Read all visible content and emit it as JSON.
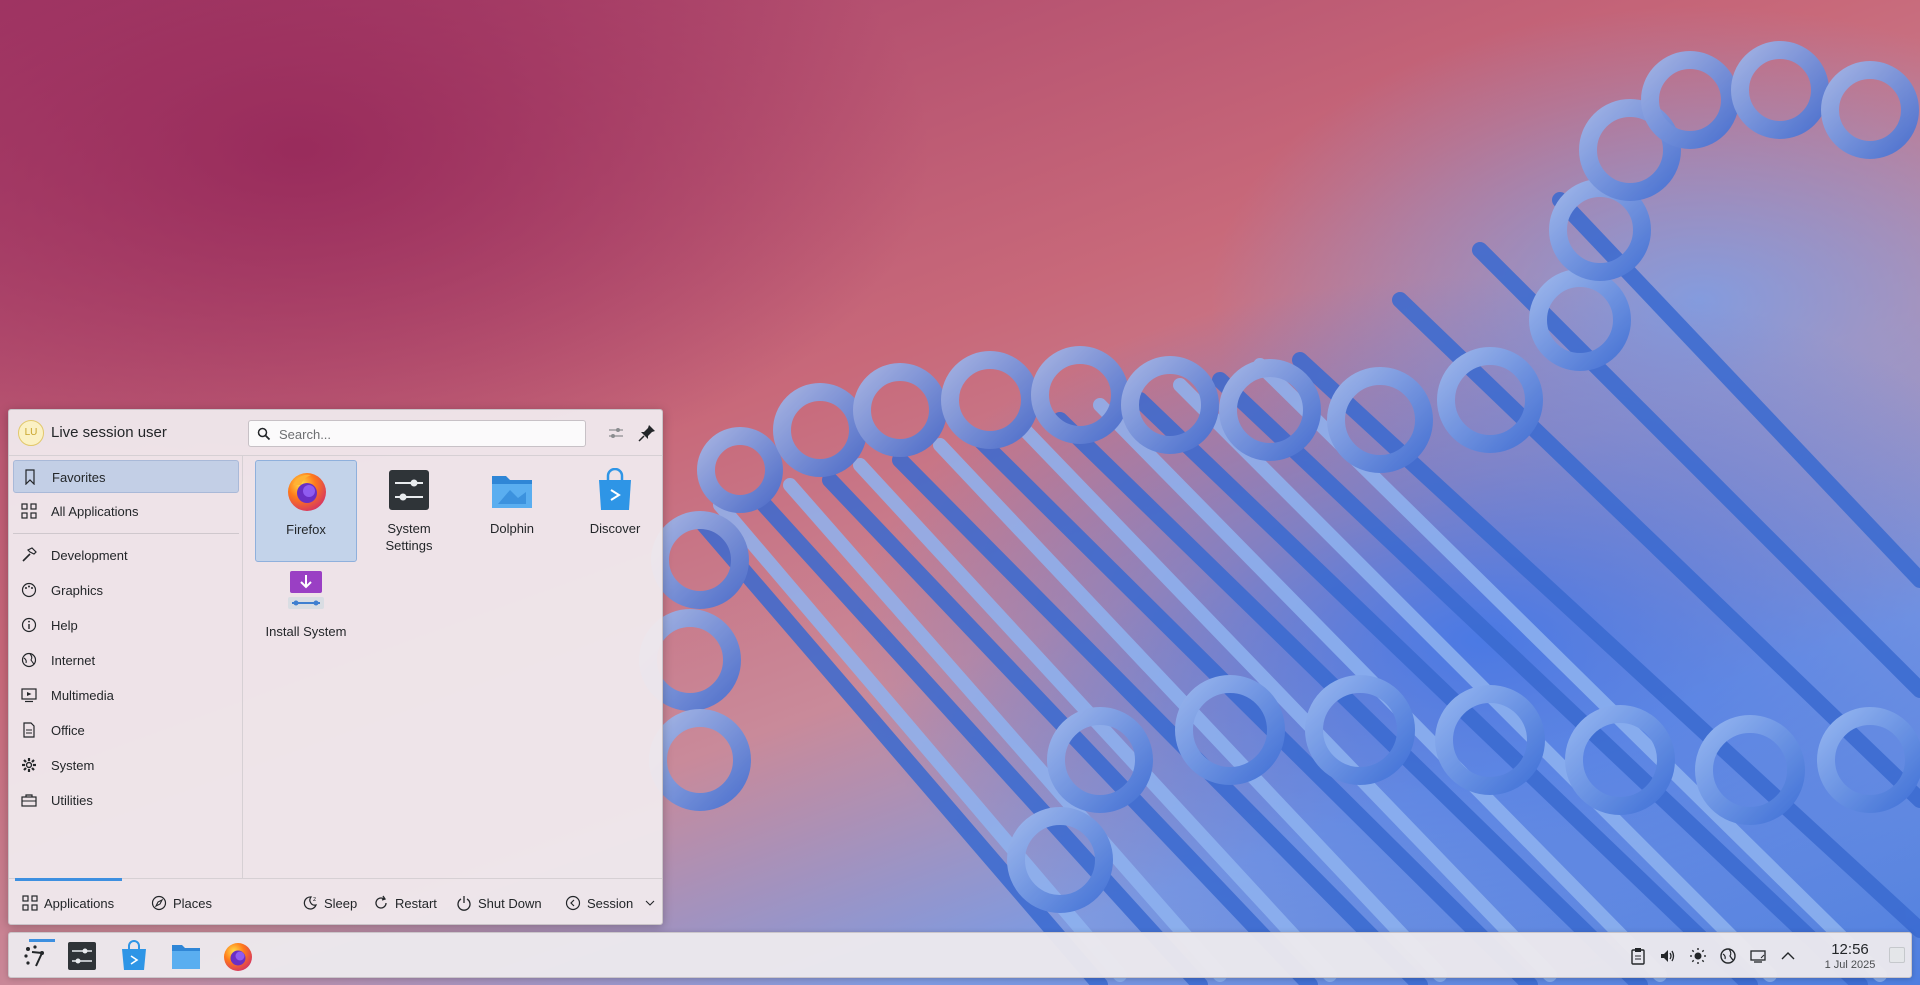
{
  "launcher": {
    "user_initials": "LU",
    "user_name": "Live session user",
    "search_placeholder": "Search...",
    "categories": [
      {
        "label": "Favorites",
        "icon": "bookmark-icon",
        "active": true
      },
      {
        "label": "All Applications",
        "icon": "grid-icon"
      },
      {
        "label": "Development",
        "icon": "hammer-icon"
      },
      {
        "label": "Graphics",
        "icon": "palette-icon"
      },
      {
        "label": "Help",
        "icon": "info-icon"
      },
      {
        "label": "Internet",
        "icon": "globe-icon"
      },
      {
        "label": "Multimedia",
        "icon": "media-icon"
      },
      {
        "label": "Office",
        "icon": "document-icon"
      },
      {
        "label": "System",
        "icon": "gear-icon"
      },
      {
        "label": "Utilities",
        "icon": "toolbox-icon"
      }
    ],
    "apps": [
      {
        "label": "Firefox",
        "icon": "firefox-icon",
        "active": true
      },
      {
        "label": "System\nSettings",
        "icon": "system-settings-icon"
      },
      {
        "label": "Dolphin",
        "icon": "folder-icon"
      },
      {
        "label": "Discover",
        "icon": "discover-bag-icon"
      },
      {
        "label": "Install System",
        "icon": "install-system-icon"
      }
    ],
    "footer": {
      "tab_applications": "Applications",
      "tab_places": "Places",
      "sleep": "Sleep",
      "restart": "Restart",
      "shut_down": "Shut Down",
      "session": "Session"
    }
  },
  "taskbar": {
    "time": "12:56",
    "date": "1 Jul 2025"
  },
  "colors": {
    "accent": "#3d8fe0",
    "selection": "#c3cfe6"
  }
}
